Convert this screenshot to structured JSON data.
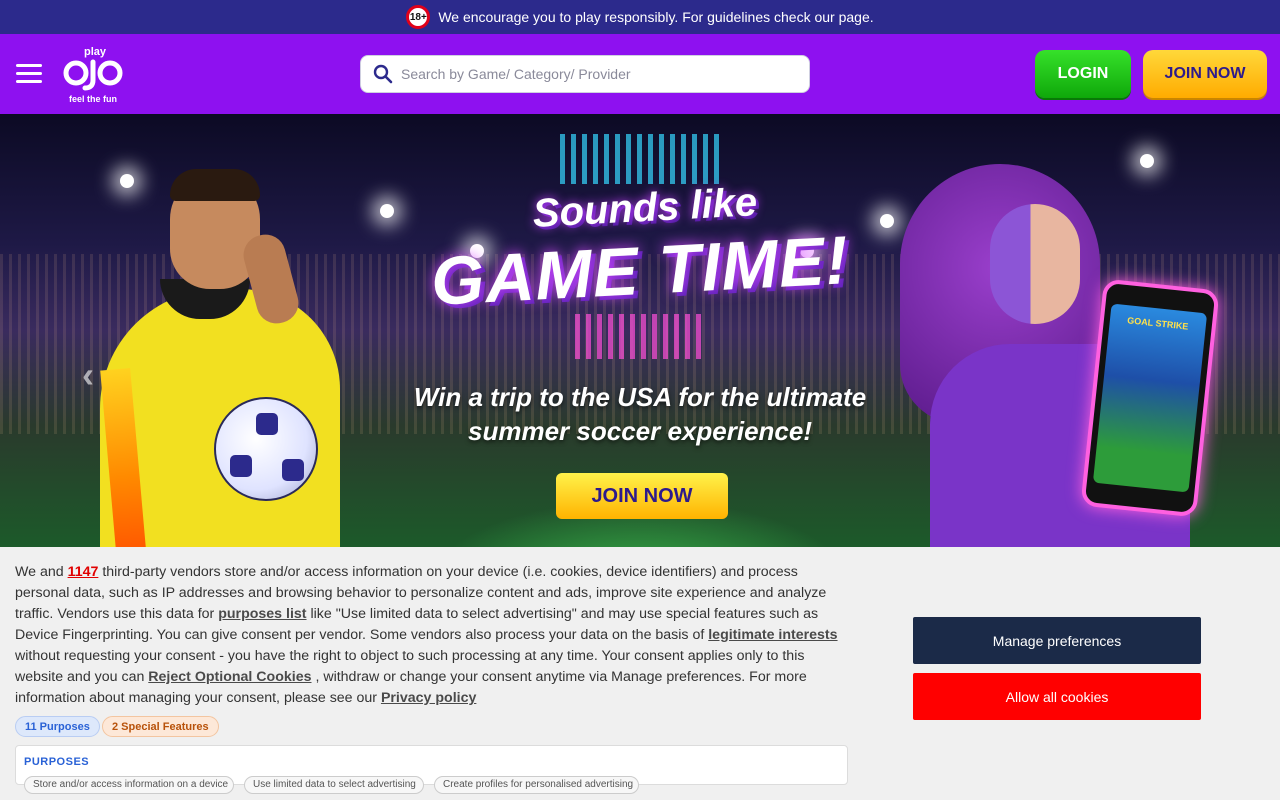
{
  "notice": {
    "age_badge": "18+",
    "text": "We encourage you to play responsibly. For guidelines check our page."
  },
  "header": {
    "logo_top": "play",
    "logo_main": "ojo",
    "logo_tagline": "feel the fun",
    "search_placeholder": "Search by Game/ Category/ Provider",
    "login_label": "LOGIN",
    "join_label": "JOIN NOW"
  },
  "hero": {
    "headline_1": "Sounds like",
    "headline_2": "GAME TIME!",
    "subtitle_line1": "Win a trip to the USA for the ultimate",
    "subtitle_line2": "summer soccer experience!",
    "cta_label": "JOIN NOW",
    "prev_arrow": "‹",
    "phone_game_title": "GOAL STRIKE"
  },
  "consent": {
    "t1": "We and ",
    "vendor_count": "1147",
    "t2": " third-party vendors store and/or access information on your device (i.e. cookies, device identifiers) and process personal data, such as IP addresses and browsing behavior to personalize content and ads, improve site experience and analyze traffic. Vendors use this data for ",
    "purposes_link": "purposes list",
    "t3": "  like \"Use limited data to select advertising\" and may use special features such as Device Fingerprinting. You can give consent per vendor. Some vendors also process your data on the basis of ",
    "legit_link": "legitimate interests",
    "t4": "  without requesting your consent - you have the right to object to such processing at any time. Your consent applies only to this website and you can ",
    "reject_link": "Reject Optional Cookies",
    "t5": " , withdraw or change your consent anytime via Manage preferences. For more information about managing your consent, please see our ",
    "privacy_link": "Privacy policy",
    "pill_purposes": "11 Purposes",
    "pill_special": "2 Special Features",
    "purposes_title": "PURPOSES",
    "chips": [
      "Store and/or access information on a device",
      "Use limited data to select advertising",
      "Create profiles for personalised advertising"
    ],
    "manage_label": "Manage preferences",
    "allow_label": "Allow all cookies"
  },
  "colors": {
    "notice_bg": "#2c2a8c",
    "header_bg": "#8e11f0",
    "login_green": "#0fa80a",
    "join_yellow": "#ffab00",
    "manage_navy": "#1b2a48",
    "allow_red": "#ff0000"
  },
  "icons": [
    "age-18-icon",
    "hamburger-menu-icon",
    "search-icon",
    "chevron-left-icon"
  ]
}
